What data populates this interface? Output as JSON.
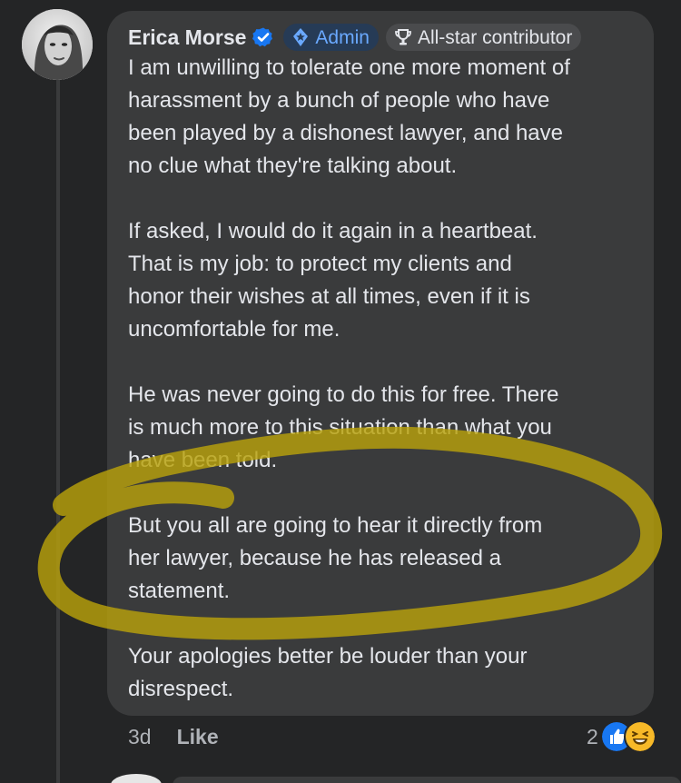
{
  "comment": {
    "author": "Erica Morse",
    "badges": {
      "admin": "Admin",
      "contributor": "All-star contributor"
    },
    "paragraphs": [
      "I am unwilling to tolerate one more moment of\nharassment by a bunch of people who have\nbeen played by a dishonest lawyer, and have\nno clue what they're talking about.",
      "If asked, I would do it again in a heartbeat.\nThat is my job: to protect my clients and\nhonor their wishes at all times, even if it is\nuncomfortable for me.",
      "He was never going to do this for free. There\nis much more to this situation than what you\nhave been told.",
      "But you all are going to hear it directly from\nher lawyer, because he has released a\nstatement.",
      "Your apologies better be louder than your\ndisrespect."
    ],
    "timestamp": "3d",
    "like_label": "Like",
    "reaction_count": "2"
  },
  "icons": {
    "verified": "verified-check-icon",
    "admin": "shield-star-icon",
    "contributor": "trophy-icon",
    "like_reaction": "thumbs-up-icon",
    "haha_reaction": "laughing-face-icon"
  },
  "colors": {
    "page_background": "#242526",
    "bubble_background": "#3a3b3c",
    "text_primary": "#e4e6eb",
    "text_secondary": "#b0b3b8",
    "verified_blue": "#1877f2",
    "admin_text": "#6aa9ff",
    "highlight_yellow": "#b8a10b"
  }
}
